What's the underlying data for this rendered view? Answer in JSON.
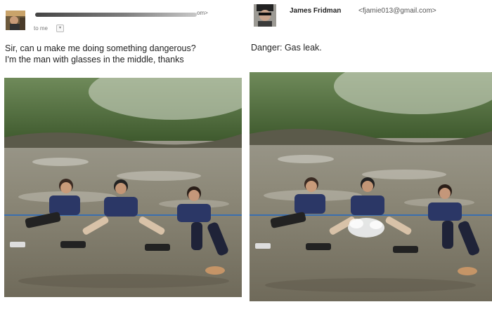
{
  "left": {
    "sender_suffix": "om>",
    "to_label": "to me",
    "dropdown_glyph": "▾",
    "message_lines": [
      "Sir, can u make me doing something dangerous?",
      "I'm the man with glasses in the middle, thanks"
    ],
    "photo_icon": "river-photo-original"
  },
  "right": {
    "sender_name": "James Fridman",
    "sender_email": "<fjamie013@gmail.com>",
    "message": "Danger: Gas leak.",
    "photo_icon": "river-photo-edited"
  },
  "colors": {
    "forest": "#4f6b3c",
    "water": "#8f8a7c",
    "shirt": "#2b3766",
    "rope": "#3b6fb0"
  }
}
